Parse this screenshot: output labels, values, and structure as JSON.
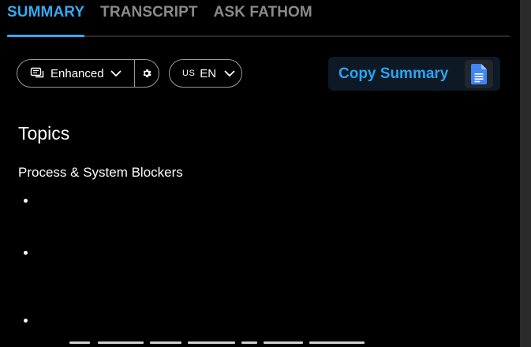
{
  "tabs": [
    {
      "label": "SUMMARY",
      "active": true
    },
    {
      "label": "TRANSCRIPT",
      "active": false
    },
    {
      "label": "ASK FATHOM",
      "active": false
    }
  ],
  "toolbar": {
    "mode_label": "Enhanced",
    "mode_icon": "summary-mode-icon",
    "settings_icon": "gear-icon",
    "language_flag": "US",
    "language_code": "EN",
    "copy_label": "Copy Summary",
    "copy_icon": "google-docs-icon"
  },
  "content": {
    "heading": "Topics",
    "section_title": "Process & System Blockers",
    "bullets": [
      "",
      "",
      ""
    ]
  },
  "colors": {
    "background": "#000000",
    "accent": "#36a9f0",
    "tab_inactive": "#8a8a8a",
    "copy_bg": "#0d1a26",
    "doc_icon": "#4285f4"
  }
}
